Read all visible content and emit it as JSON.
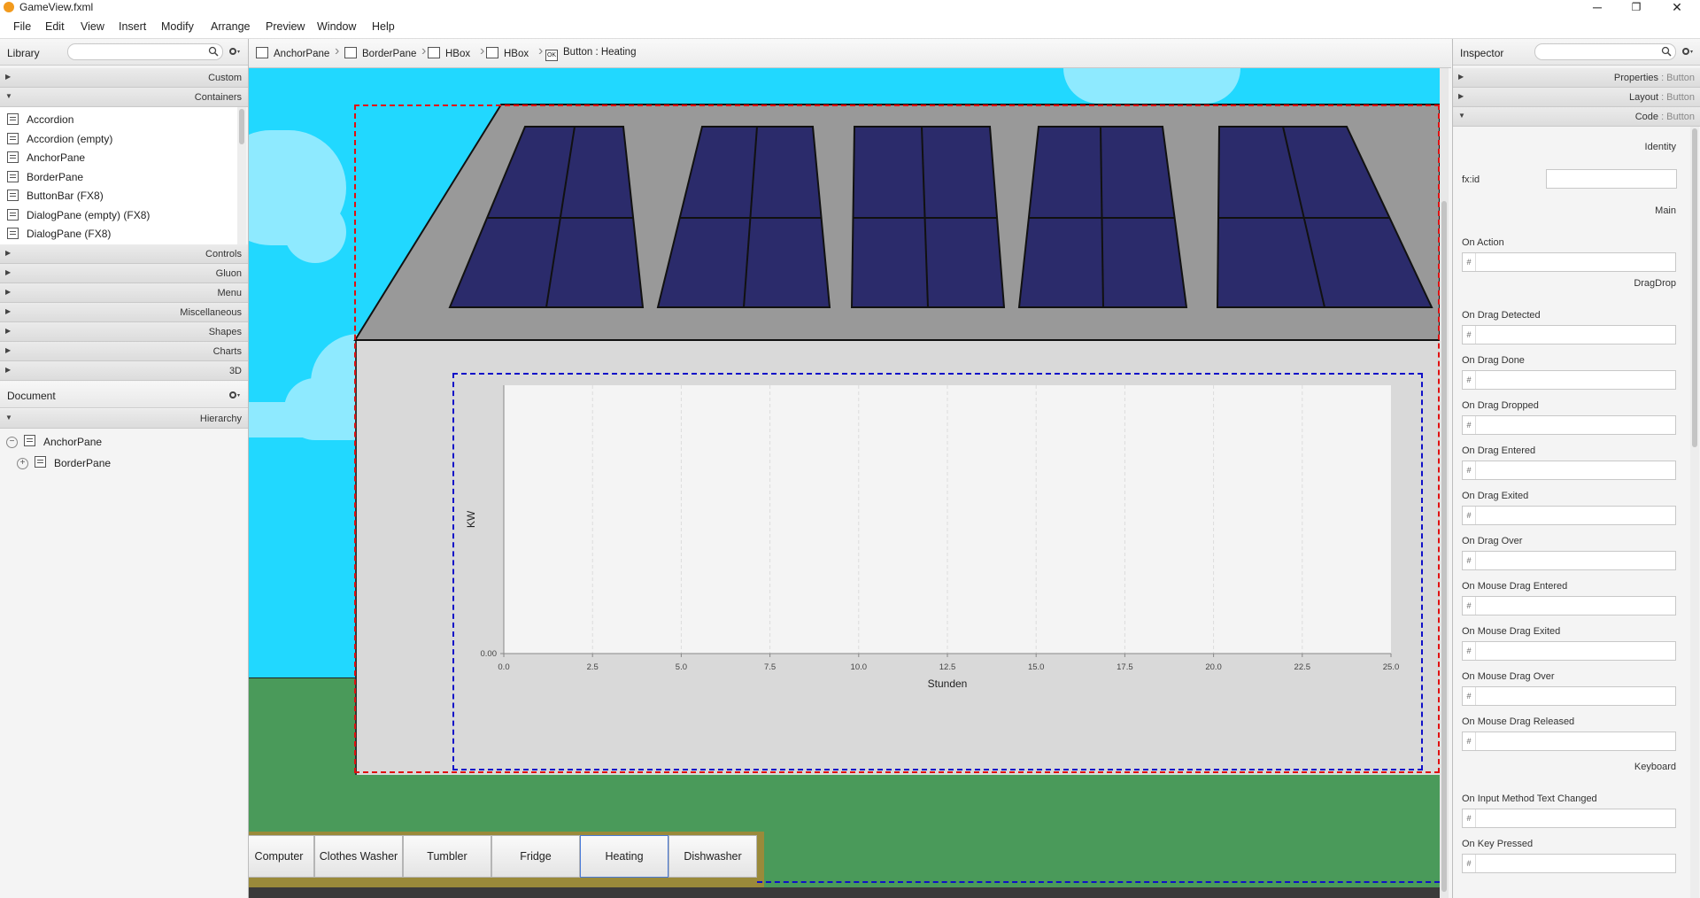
{
  "window": {
    "title": "GameView.fxml",
    "minimize": "─",
    "restore": "❐",
    "close": "✕"
  },
  "menu": [
    "File",
    "Edit",
    "View",
    "Insert",
    "Modify",
    "Arrange",
    "Preview",
    "Window",
    "Help"
  ],
  "library": {
    "title": "Library",
    "sections_top": [
      "Custom",
      "Containers"
    ],
    "items": [
      "Accordion",
      "Accordion  (empty)",
      "AnchorPane",
      "BorderPane",
      "ButtonBar  (FX8)",
      "DialogPane (empty)  (FX8)",
      "DialogPane  (FX8)"
    ],
    "sections_bottom": [
      "Controls",
      "Gluon",
      "Menu",
      "Miscellaneous",
      "Shapes",
      "Charts",
      "3D"
    ]
  },
  "document": {
    "title": "Document",
    "section": "Hierarchy",
    "tree": [
      "AnchorPane",
      "BorderPane"
    ]
  },
  "breadcrumb": [
    {
      "label": "AnchorPane",
      "icon": "anchorpane-icon"
    },
    {
      "label": "BorderPane",
      "icon": "borderpane-icon"
    },
    {
      "label": "HBox",
      "icon": "hbox-icon"
    },
    {
      "label": "HBox",
      "icon": "hbox-icon"
    },
    {
      "label": "Button : Heating",
      "icon": "button-ok-icon",
      "icon_text": "OK"
    }
  ],
  "inspector": {
    "title": "Inspector",
    "sections": [
      {
        "name": "Properties",
        "target": " : Button"
      },
      {
        "name": "Layout",
        "target": " : Button"
      },
      {
        "name": "Code",
        "target": " : Button"
      }
    ],
    "groups": {
      "identity": "Identity",
      "main": "Main",
      "dragdrop": "DragDrop",
      "keyboard": "Keyboard"
    },
    "fxid_label": "fx:id",
    "on_action": "On Action",
    "drag_fields": [
      "On Drag Detected",
      "On Drag Done",
      "On Drag Dropped",
      "On Drag Entered",
      "On Drag Exited",
      "On Drag Over",
      "On Mouse Drag Entered",
      "On Mouse Drag Exited",
      "On Mouse Drag Over",
      "On Mouse Drag Released"
    ],
    "keyboard_fields": [
      "On Input Method Text Changed",
      "On Key Pressed"
    ],
    "hash": "#"
  },
  "appliances": [
    "Computer",
    "Clothes Washer",
    "Tumbler",
    "Fridge",
    "Heating",
    "Dishwasher"
  ],
  "colors": {
    "sky": "#21d8ff",
    "grass": "#4a9a5a",
    "roof": "#999999",
    "panel": "#2b2b6b",
    "house_wall": "#d9d9d9",
    "selection_red": "#e01010",
    "selection_blue": "#1010c8",
    "button_bar_border": "#9a8a3a"
  },
  "chart_data": {
    "type": "line",
    "xlabel": "Stunden",
    "ylabel": "KW",
    "xlim": [
      0,
      25
    ],
    "ylim": [
      0,
      0
    ],
    "x_ticks": [
      "0.0",
      "2.5",
      "5.0",
      "7.5",
      "10.0",
      "12.5",
      "15.0",
      "17.5",
      "20.0",
      "22.5",
      "25.0"
    ],
    "y_ticks": [
      "0.00"
    ],
    "series": [],
    "grid": true
  }
}
